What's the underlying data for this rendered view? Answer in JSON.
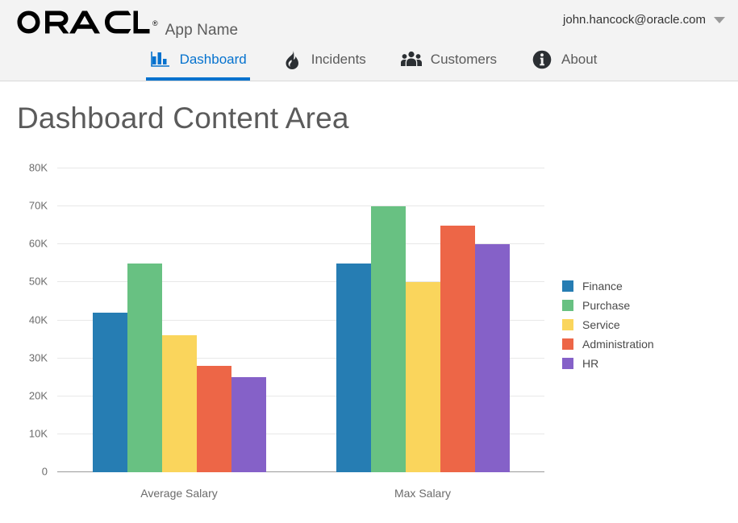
{
  "header": {
    "brand": "ORACLE",
    "brand_registered": "®",
    "app_name": "App Name",
    "user_email": "john.hancock@oracle.com",
    "caret_icon": "chevron-down-icon",
    "accent_color": "#0572ce",
    "background_color": "#f3f3f3"
  },
  "nav": {
    "tabs": [
      {
        "label": "Dashboard",
        "icon": "bar-chart-icon",
        "active": true
      },
      {
        "label": "Incidents",
        "icon": "flame-icon",
        "active": false
      },
      {
        "label": "Customers",
        "icon": "people-group-icon",
        "active": false
      },
      {
        "label": "About",
        "icon": "info-circle-icon",
        "active": false
      }
    ]
  },
  "main": {
    "page_title": "Dashboard Content Area"
  },
  "chart_data": {
    "type": "bar",
    "title": "",
    "xlabel": "",
    "ylabel": "",
    "categories": [
      "Average Salary",
      "Max Salary"
    ],
    "series": [
      {
        "name": "Finance",
        "color": "#267db3",
        "values": [
          42000,
          55000
        ]
      },
      {
        "name": "Purchase",
        "color": "#68c182",
        "values": [
          55000,
          70000
        ]
      },
      {
        "name": "Service",
        "color": "#fad55c",
        "values": [
          36000,
          50000
        ]
      },
      {
        "name": "Administration",
        "color": "#ed6647",
        "values": [
          28000,
          65000
        ]
      },
      {
        "name": "HR",
        "color": "#8561c8",
        "values": [
          25000,
          60000
        ]
      }
    ],
    "ylim": [
      0,
      80000
    ],
    "ytick_values": [
      0,
      10000,
      20000,
      30000,
      40000,
      50000,
      60000,
      70000,
      80000
    ],
    "ytick_labels": [
      "0",
      "10K",
      "20K",
      "30K",
      "40K",
      "50K",
      "60K",
      "70K",
      "80K"
    ],
    "grid": true,
    "legend_position": "right"
  }
}
